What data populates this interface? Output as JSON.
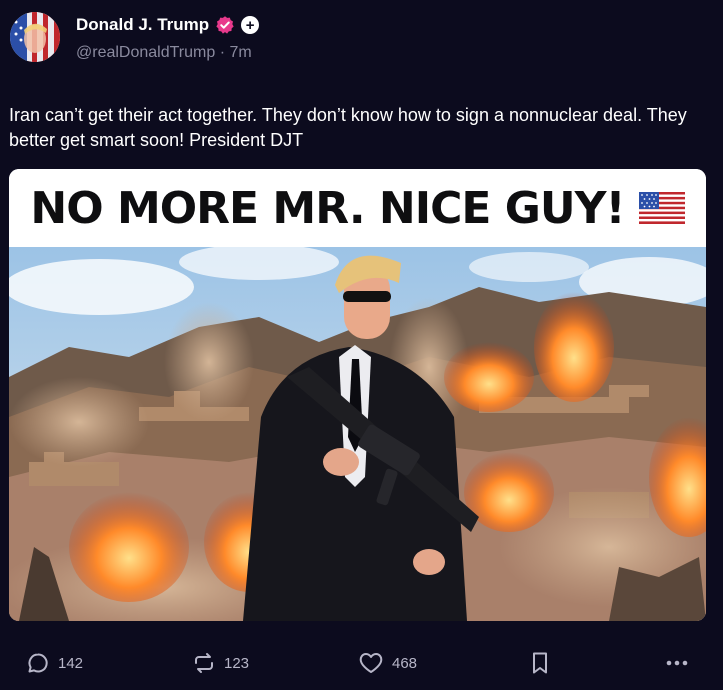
{
  "author": {
    "display_name": "Donald J. Trump",
    "handle": "@realDonaldTrump",
    "separator": "·",
    "time_ago": "7m",
    "verified_color": "#e8398c",
    "plus_badge": "+"
  },
  "post": {
    "text": "Iran can’t get their act together. They don’t know how to sign a nonnuclear deal. They better get smart soon! President DJT",
    "media": {
      "banner_text": "NO MORE MR. NICE GUY!",
      "banner_icon": "us-flag-icon"
    }
  },
  "actions": {
    "reply": {
      "icon": "comment-icon",
      "count": "142"
    },
    "repost": {
      "icon": "repost-icon",
      "count": "123"
    },
    "like": {
      "icon": "heart-icon",
      "count": "468"
    },
    "bookmark": {
      "icon": "bookmark-icon"
    },
    "more": {
      "icon": "more-icon"
    }
  },
  "colors": {
    "background": "#0c0b1e",
    "secondary_text": "#8a8a9e",
    "action_text": "#b7b6c8"
  }
}
